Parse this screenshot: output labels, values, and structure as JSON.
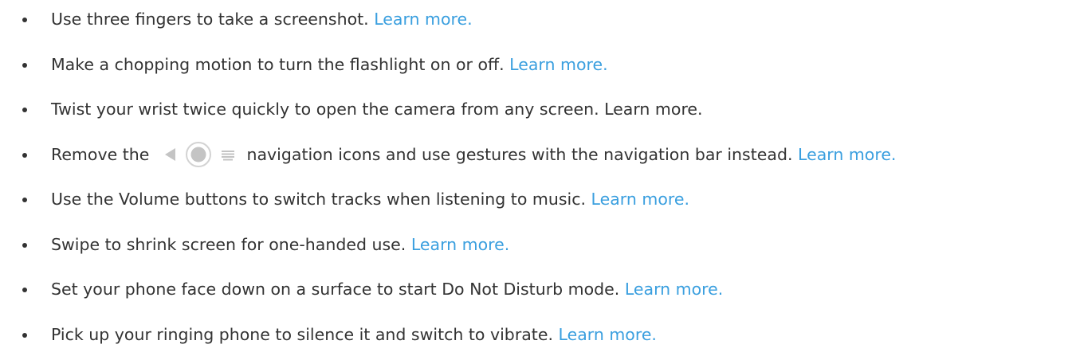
{
  "items": [
    {
      "text": "Use three fingers to take a screenshot.",
      "link": "Learn more."
    },
    {
      "text": "Make a chopping motion to turn the flashlight on or off.",
      "link": "Learn more."
    },
    {
      "text": "Twist your wrist twice quickly to open the camera from any screen.",
      "link": "Learn more."
    },
    {
      "text_before": "Remove the",
      "icons": [
        "back-icon",
        "home-icon",
        "recents-icon"
      ],
      "text_after": "navigation icons and use gestures with the navigation bar instead.",
      "link": "Learn more."
    },
    {
      "text": "Use the Volume buttons to switch tracks when listening to music.",
      "link": "Learn more."
    },
    {
      "text": "Swipe to shrink screen for one-handed use.",
      "link": "Learn more."
    },
    {
      "text": "Set your phone face down on a surface to start Do Not Disturb mode.",
      "link": "Learn more."
    },
    {
      "text": "Pick up your ringing phone to silence it and switch to vibrate.",
      "link": "Learn more."
    }
  ],
  "colors": {
    "text": "#333333",
    "link": "#3a9fdf",
    "icon": "#c4c4c4"
  }
}
